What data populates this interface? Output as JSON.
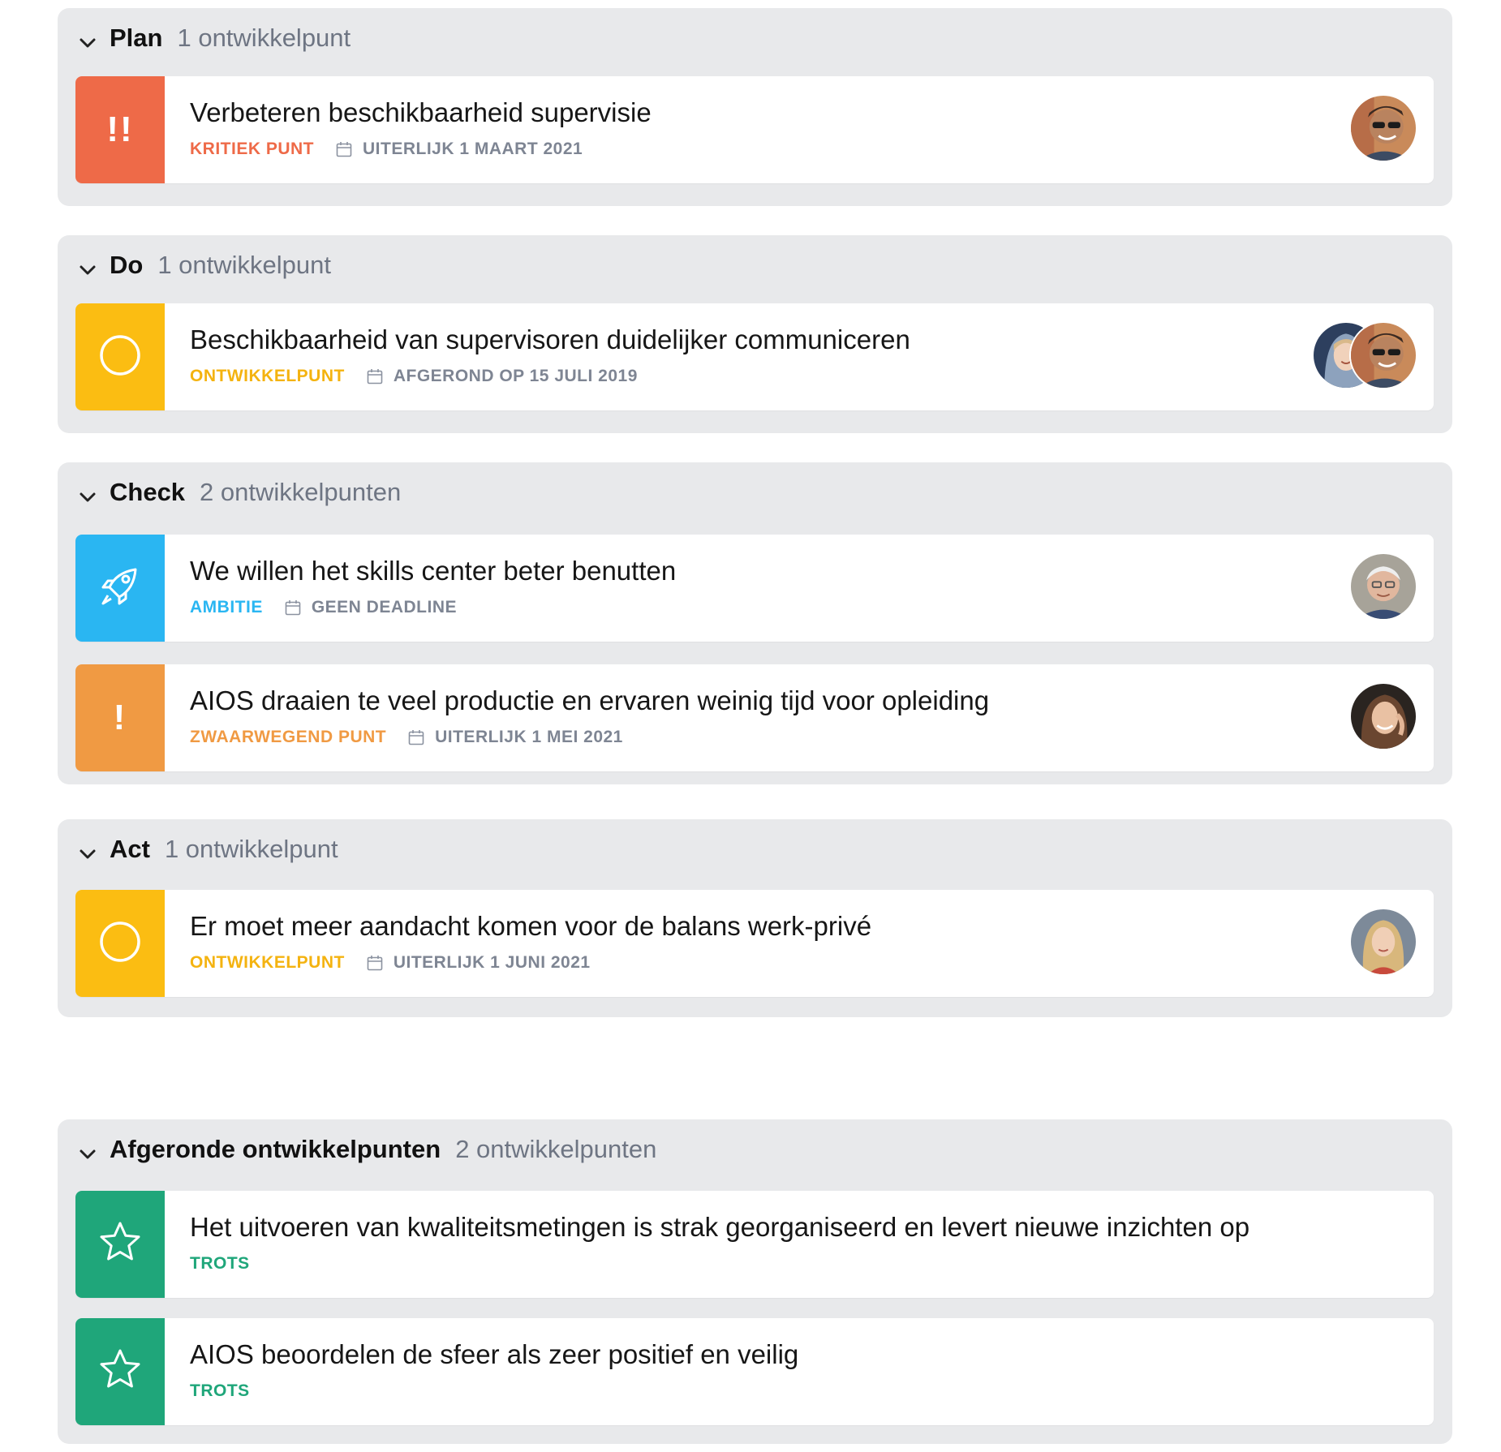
{
  "colors": {
    "kritiek": "#ee6a48",
    "ontwikkel": "#fbbd12",
    "ambitie": "#2ab6f2",
    "zwaarwegend": "#f09a43",
    "trots": "#1fa67a"
  },
  "groups": [
    {
      "title": "Plan",
      "count": "1 ontwikkelpunt",
      "items": [
        {
          "title": "Verbeteren beschikbaarheid supervisie",
          "type": "KRITIEK PUNT",
          "date": "UITERLIJK 1 MAART 2021",
          "icon": "double-exclamation-icon",
          "icon_text": "!!",
          "avatars": [
            "man-sunglasses-avatar"
          ]
        }
      ]
    },
    {
      "title": "Do",
      "count": "1 ontwikkelpunt",
      "items": [
        {
          "title": "Beschikbaarheid van supervisoren duidelijker communiceren",
          "type": "ONTWIKKELPUNT",
          "date": "AFGEROND OP 15 JULI 2019",
          "icon": "circle-icon",
          "avatars": [
            "woman-hood-avatar",
            "man-sunglasses-avatar"
          ]
        }
      ]
    },
    {
      "title": "Check",
      "count": "2 ontwikkelpunten",
      "items": [
        {
          "title": "We willen het skills center beter benutten",
          "type": "AMBITIE",
          "date": "GEEN DEADLINE",
          "icon": "rocket-icon",
          "avatars": [
            "older-man-avatar"
          ]
        },
        {
          "title": "AIOS draaien te veel productie en ervaren weinig tijd voor opleiding",
          "type": "ZWAARWEGEND PUNT",
          "date": "UITERLIJK 1 MEI 2021",
          "icon": "exclamation-icon",
          "icon_text": "!",
          "avatars": [
            "woman-smiling-avatar"
          ]
        }
      ]
    },
    {
      "title": "Act",
      "count": "1 ontwikkelpunt",
      "items": [
        {
          "title": "Er moet meer aandacht komen voor de balans werk-privé",
          "type": "ONTWIKKELPUNT",
          "date": "UITERLIJK 1 JUNI 2021",
          "icon": "circle-icon",
          "avatars": [
            "blonde-woman-avatar"
          ]
        }
      ]
    },
    {
      "title": "Afgeronde ontwikkelpunten",
      "count": "2 ontwikkelpunten",
      "items": [
        {
          "title": "Het uitvoeren van kwaliteitsmetingen is strak georganiseerd en levert nieuwe inzichten op",
          "type": "TROTS",
          "icon": "star-icon"
        },
        {
          "title": "AIOS beoordelen de sfeer als zeer positief en veilig",
          "type": "TROTS",
          "icon": "star-icon"
        }
      ]
    }
  ]
}
